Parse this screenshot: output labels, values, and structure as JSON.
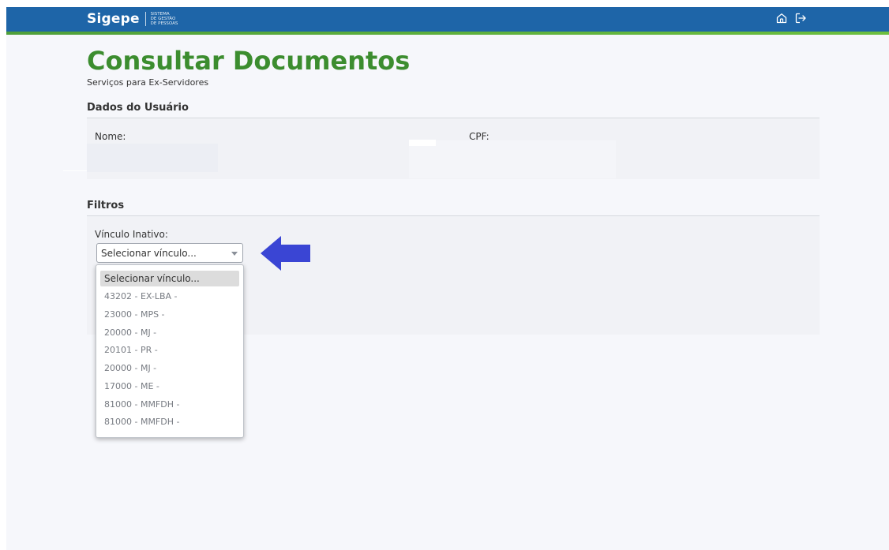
{
  "header": {
    "logo_text": "Sigepe",
    "logo_subtitle_line1": "SISTEMA",
    "logo_subtitle_line2": "DE GESTÃO",
    "logo_subtitle_line3": "DE PESSOAS",
    "icons": [
      "home-icon",
      "logout-icon"
    ]
  },
  "page": {
    "title": "Consultar Documentos",
    "subtitle": "Serviços para Ex-Servidores"
  },
  "user_data": {
    "heading": "Dados do Usuário",
    "name_label": "Nome:",
    "cpf_label": "CPF:"
  },
  "filters": {
    "heading": "Filtros",
    "vinculo_label": "Vínculo Inativo:",
    "select_value": "Selecionar vínculo...",
    "options": [
      "Selecionar vínculo...",
      "43202 - EX-LBA -",
      "23000 - MPS -",
      "20000 - MJ -",
      "20101 - PR -",
      "20000 - MJ -",
      "17000 - ME -",
      "81000 - MMFDH -",
      "81000 - MMFDH -"
    ]
  },
  "colors": {
    "header_blue": "#1e65a8",
    "title_green": "#3c8d2f",
    "arrow_blue": "#3a45d4"
  }
}
